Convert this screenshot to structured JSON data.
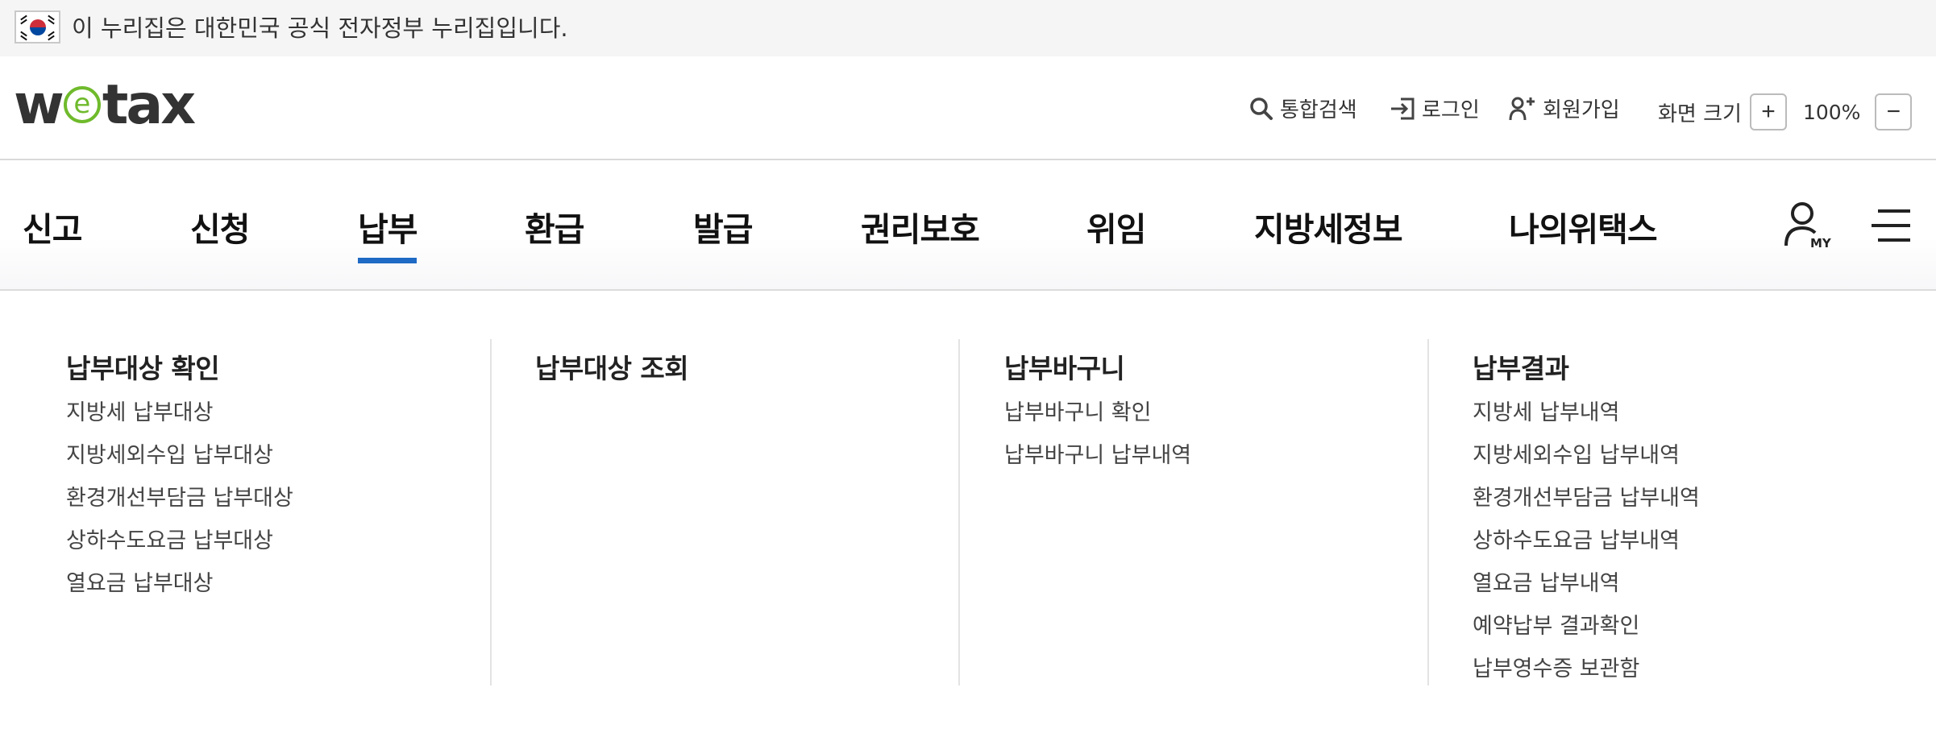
{
  "gov_banner": {
    "text": "이 누리집은 대한민국 공식 전자정부 누리집입니다."
  },
  "header": {
    "logo_text_before": "w",
    "logo_text_e": "e",
    "logo_text_after": "tax",
    "search_label": "통합검색",
    "login_label": "로그인",
    "join_label": "회원가입",
    "zoom_label": "화면 크기",
    "zoom_plus": "+",
    "zoom_value": "100%",
    "zoom_minus": "−"
  },
  "nav": {
    "items": [
      {
        "label": "신고"
      },
      {
        "label": "신청"
      },
      {
        "label": "납부"
      },
      {
        "label": "환급"
      },
      {
        "label": "발급"
      },
      {
        "label": "권리보호"
      },
      {
        "label": "위임"
      },
      {
        "label": "지방세정보"
      },
      {
        "label": "나의위택스"
      }
    ],
    "active_index": 2,
    "my_label": "MY"
  },
  "mega_menu": {
    "columns": [
      {
        "title": "납부대상 확인",
        "links": [
          "지방세 납부대상",
          "지방세외수입 납부대상",
          "환경개선부담금 납부대상",
          "상하수도요금 납부대상",
          "열요금 납부대상"
        ]
      },
      {
        "title": "납부대상 조회",
        "links": []
      },
      {
        "title": "납부바구니",
        "links": [
          "납부바구니 확인",
          "납부바구니 납부내역"
        ]
      },
      {
        "title": "납부결과",
        "links": [
          "지방세 납부내역",
          "지방세외수입 납부내역",
          "환경개선부담금 납부내역",
          "상하수도요금 납부내역",
          "열요금 납부내역",
          "예약납부 결과확인",
          "납부영수증 보관함"
        ]
      }
    ]
  },
  "colors": {
    "accent": "#1e6ac4",
    "logo_green": "#6fba2c",
    "banner_bg": "#f5f5f5"
  },
  "icons": [
    "korea-flag-icon",
    "search-icon",
    "login-icon",
    "join-user-icon",
    "my-user-icon",
    "hamburger-menu-icon"
  ]
}
